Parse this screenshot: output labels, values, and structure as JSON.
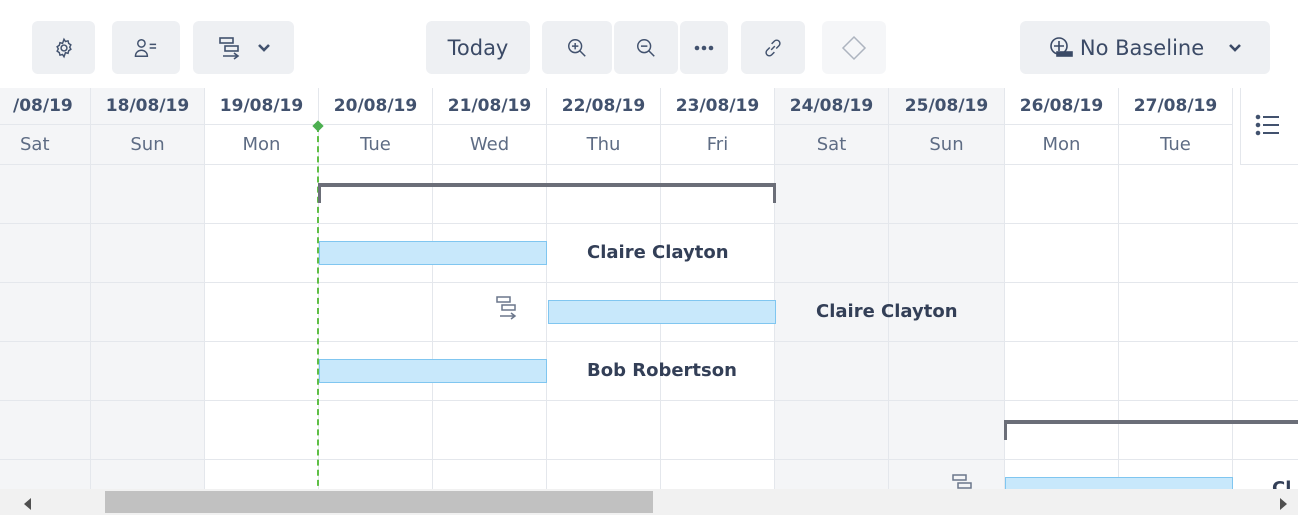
{
  "toolbar": {
    "settings_icon": "gear-icon",
    "resources_icon": "user-list-icon",
    "group_icon": "hierarchy-icon",
    "group_dropdown_icon": "chevron-down-icon",
    "today_label": "Today",
    "zoom_in_icon": "zoom-in-icon",
    "zoom_out_icon": "zoom-out-icon",
    "more_icon": "ellipsis-icon",
    "link_icon": "link-icon",
    "milestone_icon": "diamond-icon",
    "baseline_icon": "baseline-icon",
    "baseline_label": "No Baseline",
    "baseline_dropdown_icon": "chevron-down-icon"
  },
  "timeline": {
    "columns": [
      {
        "date": "/08/19",
        "day": "Sat"
      },
      {
        "date": "18/08/19",
        "day": "Sun"
      },
      {
        "date": "19/08/19",
        "day": "Mon"
      },
      {
        "date": "20/08/19",
        "day": "Tue"
      },
      {
        "date": "21/08/19",
        "day": "Wed"
      },
      {
        "date": "22/08/19",
        "day": "Thu"
      },
      {
        "date": "23/08/19",
        "day": "Fri"
      },
      {
        "date": "24/08/19",
        "day": "Sat"
      },
      {
        "date": "25/08/19",
        "day": "Sun"
      },
      {
        "date": "26/08/19",
        "day": "Mon"
      },
      {
        "date": "27/08/19",
        "day": "Tue"
      }
    ],
    "side_panel_icon": "list-icon"
  },
  "tasks": {
    "assignees": [
      "Claire Clayton",
      "Claire Clayton",
      "Bob Robertson",
      "Cl"
    ]
  },
  "colors": {
    "task_bar": "#c8e8fb",
    "task_border": "#80c6f0",
    "group_bar": "#6b6e78",
    "today_line": "#5fbf45",
    "weekend": "#f4f5f7"
  }
}
